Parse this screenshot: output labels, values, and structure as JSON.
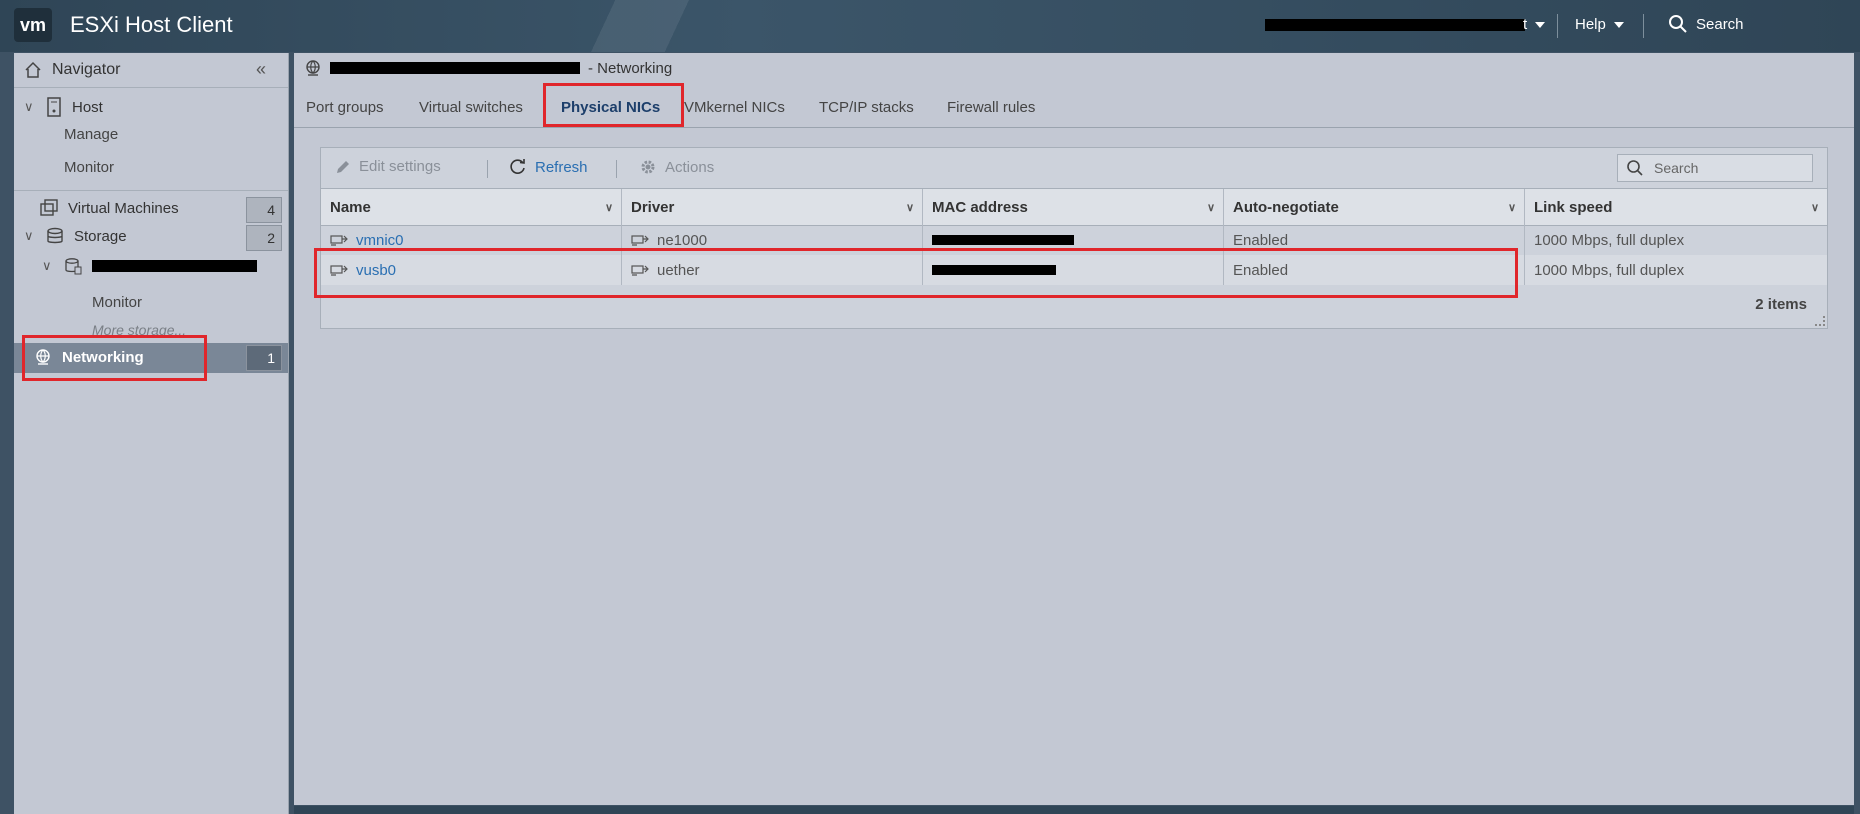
{
  "app": {
    "logo_text": "vm",
    "title": "ESXi Host Client",
    "user_suffix": "t",
    "help_label": "Help",
    "search_label": "Search"
  },
  "navigator": {
    "title": "Navigator",
    "host": {
      "label": "Host",
      "children": [
        "Manage",
        "Monitor"
      ]
    },
    "virtual_machines": {
      "label": "Virtual Machines",
      "count": "4"
    },
    "storage": {
      "label": "Storage",
      "count": "2",
      "datastore_children": [
        "Monitor"
      ],
      "more": "More storage..."
    },
    "networking": {
      "label": "Networking",
      "count": "1"
    }
  },
  "main": {
    "header_suffix": "- Networking",
    "tabs": [
      "Port groups",
      "Virtual switches",
      "Physical NICs",
      "VMkernel NICs",
      "TCP/IP stacks",
      "Firewall rules"
    ],
    "active_tab": "Physical NICs",
    "toolbar": {
      "edit": "Edit settings",
      "refresh": "Refresh",
      "actions": "Actions",
      "search_placeholder": "Search"
    },
    "table": {
      "columns": [
        "Name",
        "Driver",
        "MAC address",
        "Auto-negotiate",
        "Link speed"
      ],
      "rows": [
        {
          "name": "vmnic0",
          "driver": "ne1000",
          "mac": "",
          "auto_negotiate": "Enabled",
          "link_speed": "1000 Mbps, full duplex"
        },
        {
          "name": "vusb0",
          "driver": "uether",
          "mac": "",
          "auto_negotiate": "Enabled",
          "link_speed": "1000 Mbps, full duplex"
        }
      ],
      "footer": "2 items"
    }
  },
  "colors": {
    "highlight": "#e0262b",
    "link": "#2a6fb2",
    "topbar": "#2f4556"
  }
}
